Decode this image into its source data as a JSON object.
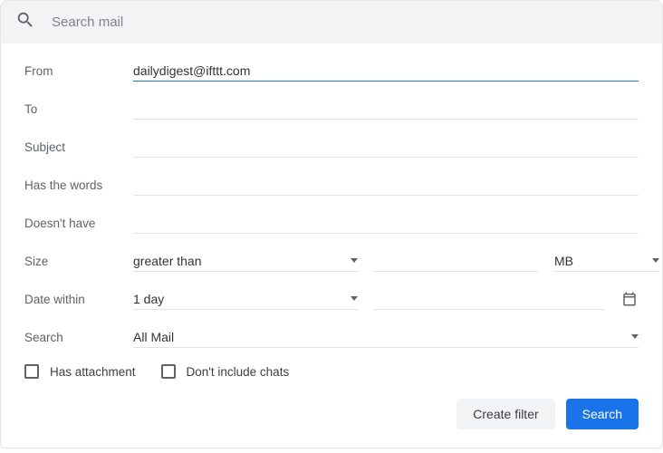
{
  "search": {
    "placeholder": "Search mail"
  },
  "form": {
    "from": {
      "label": "From",
      "value": "dailydigest@ifttt.com"
    },
    "to": {
      "label": "To",
      "value": ""
    },
    "subject": {
      "label": "Subject",
      "value": ""
    },
    "hasWords": {
      "label": "Has the words",
      "value": ""
    },
    "notHave": {
      "label": "Doesn't have",
      "value": ""
    },
    "size": {
      "label": "Size",
      "comparator": "greater than",
      "value": "",
      "unit": "MB"
    },
    "dateWithin": {
      "label": "Date within",
      "range": "1 day",
      "value": ""
    },
    "searchScope": {
      "label": "Search",
      "value": "All Mail"
    }
  },
  "checks": {
    "hasAttachment": {
      "label": "Has attachment",
      "checked": false
    },
    "excludeChats": {
      "label": "Don't include chats",
      "checked": false
    }
  },
  "buttons": {
    "createFilter": "Create filter",
    "search": "Search"
  }
}
